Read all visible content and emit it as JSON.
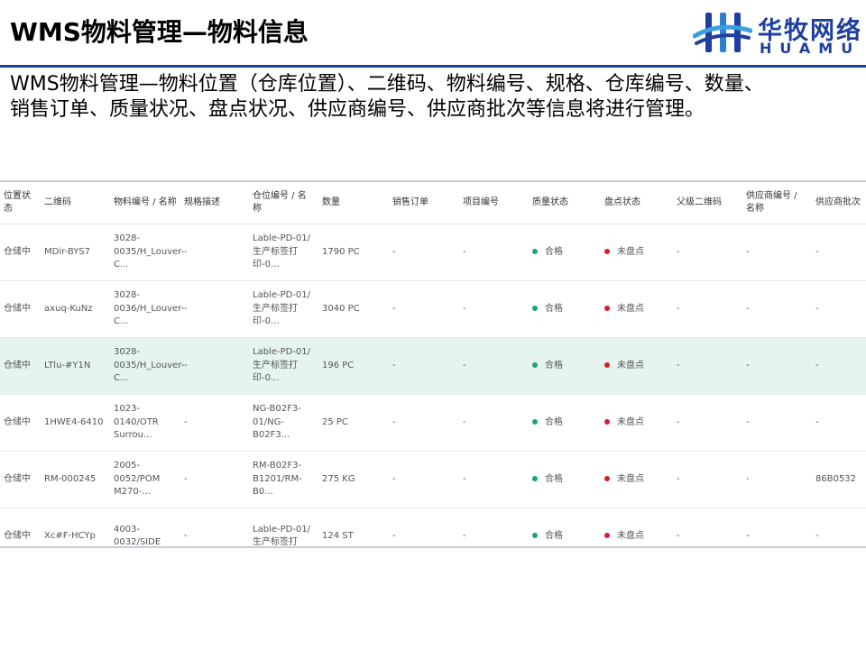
{
  "slide": {
    "title": "WMS物料管理—物料信息",
    "description": "WMS物料管理—物料位置（仓库位置）、二维码、物料编号、规格、仓库编号、数量、销售订单、质量状况、盘点状况、供应商编号、供应商批次等信息将进行管理。"
  },
  "logo": {
    "cn": "华牧网络",
    "en": "HUAMU",
    "color": "#1f3fa0"
  },
  "table": {
    "columns": [
      "位置状态",
      "二维码",
      "物料编号 / 名称",
      "规格描述",
      "仓位编号 / 名称",
      "数量",
      "销售订单",
      "项目编号",
      "质量状态",
      "盘点状态",
      "父级二维码",
      "供应商编号 / 名称",
      "供应商批次"
    ],
    "rows": [
      [
        "仓储中",
        "MDir-BYS7",
        "3028-0035/H_Louver-C...",
        "-",
        "Lable-PD-01/生产标签打印-0...",
        "1790 PC",
        "-",
        "-",
        "合格",
        "未盘点",
        "-",
        "-",
        "-"
      ],
      [
        "仓储中",
        "axuq-KuNz",
        "3028-0036/H_Louver-C...",
        "-",
        "Lable-PD-01/生产标签打印-0...",
        "3040 PC",
        "-",
        "-",
        "合格",
        "未盘点",
        "-",
        "-",
        "-"
      ],
      [
        "仓储中",
        "LTlu-#Y1N",
        "3028-0035/H_Louver-C...",
        "-",
        "Lable-PD-01/生产标签打印-0...",
        "196 PC",
        "-",
        "-",
        "合格",
        "未盘点",
        "-",
        "-",
        "-"
      ],
      [
        "仓储中",
        "1HWE4-6410",
        "1023-0140/OTR Surrou...",
        "-",
        "NG-B02F3-01/NG-B02F3...",
        "25 PC",
        "-",
        "-",
        "合格",
        "未盘点",
        "-",
        "-",
        "-"
      ],
      [
        "仓储中",
        "RM-000245",
        "2005-0052/POM M270-...",
        "-",
        "RM-B02F3-B1201/RM-B0...",
        "275 KG",
        "-",
        "-",
        "合格",
        "未盘点",
        "-",
        "-",
        "86B0532"
      ],
      [
        "仓储中",
        "Xc#F-HCYp",
        "4003-0032/SIDE",
        "-",
        "Lable-PD-01/生产标签打",
        "124 ST",
        "-",
        "-",
        "合格",
        "未盘点",
        "-",
        "-",
        "-"
      ]
    ],
    "highlight_row": 2,
    "status_colors": {
      "合格": "#1aa37a",
      "未盘点": "#d4202a"
    }
  }
}
